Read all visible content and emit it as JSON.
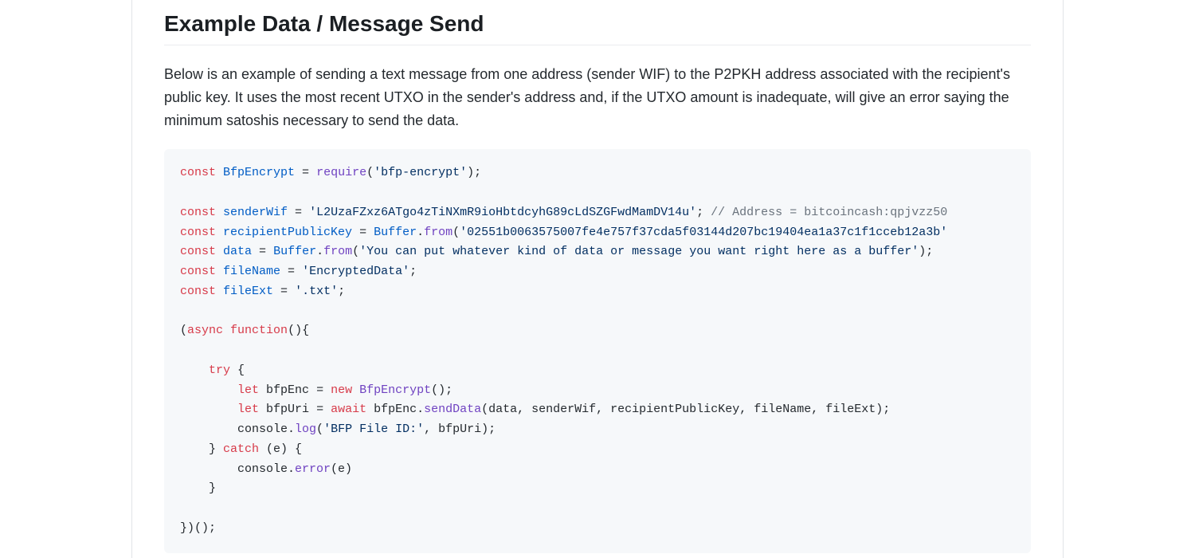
{
  "heading": "Example Data / Message Send",
  "intro": "Below is an example of sending a text message from one address (sender WIF) to the P2PKH address associated with the recipient's public key. It uses the most recent UTXO in the sender's address and, if the UTXO amount is inadequate, will give an error saying the minimum satoshis necessary to send the data.",
  "code": {
    "kw_const1": "const",
    "def_BfpEncrypt": "BfpEncrypt",
    "pln_eq1": " = ",
    "fn_require": "require",
    "pln_paren_o1": "(",
    "str_bfp_encrypt": "'bfp-encrypt'",
    "pln_close1": ");",
    "kw_const2": "const",
    "def_senderWif": "senderWif",
    "pln_eq2": " = ",
    "str_senderWif": "'L2UzaFZxz6ATgo4zTiNXmR9ioHbtdcyhG89cLdSZGFwdMamDV14u'",
    "pln_semi2": "; ",
    "cmt_address": "// Address = bitcoincash:qpjvzz50",
    "kw_const3": "const",
    "def_recipientPublicKey": "recipientPublicKey",
    "pln_eq3": " = ",
    "def_Buffer1": "Buffer",
    "pln_dot1": ".",
    "fn_from1": "from",
    "pln_paren_o3": "(",
    "str_pubkey": "'02551b0063575007fe4e757f37cda5f03144d207bc19404ea1a37c1f1cceb12a3b'",
    "kw_const4": "const",
    "def_data": "data",
    "pln_eq4": " = ",
    "def_Buffer2": "Buffer",
    "pln_dot2": ".",
    "fn_from2": "from",
    "pln_paren_o4": "(",
    "str_data": "'You can put whatever kind of data or message you want right here as a buffer'",
    "pln_close4": ");",
    "kw_const5": "const",
    "def_fileName": "fileName",
    "pln_eq5": " = ",
    "str_fileName": "'EncryptedData'",
    "pln_semi5": ";",
    "kw_const6": "const",
    "def_fileExt": "fileExt",
    "pln_eq6": " = ",
    "str_fileExt": "'.txt'",
    "pln_semi6": ";",
    "pln_async_open": "(",
    "kw_async": "async",
    "pln_space1": " ",
    "kw_function": "function",
    "pln_func_sig": "(){",
    "kw_try": "try",
    "pln_try_brace": " {",
    "kw_let1": "let",
    "pln_sp_let1": " ",
    "pln_bfpEnc": "bfpEnc ",
    "pln_eq7": "= ",
    "kw_new": "new",
    "pln_sp_new": " ",
    "fn_BfpEncryptCtor": "BfpEncrypt",
    "pln_ctor_close": "();",
    "kw_let2": "let",
    "pln_sp_let2": " ",
    "pln_bfpUri": "bfpUri ",
    "pln_eq8": "= ",
    "kw_await": "await",
    "pln_sp_await": " ",
    "pln_bfpEnc2": "bfpEnc.",
    "fn_sendData": "sendData",
    "pln_sendArgs": "(data, senderWif, recipientPublicKey, fileName, fileExt);",
    "pln_console1": "console.",
    "fn_log": "log",
    "pln_log_o": "(",
    "str_bfp_file_id": "'BFP File ID:'",
    "pln_log_rest": ", bfpUri);",
    "pln_try_close": "} ",
    "kw_catch": "catch",
    "pln_catch_sig": " (e) {",
    "pln_console2": "console.",
    "fn_error": "error",
    "pln_error_args": "(e)",
    "pln_catch_close": "}",
    "pln_iife_close": "})();"
  }
}
